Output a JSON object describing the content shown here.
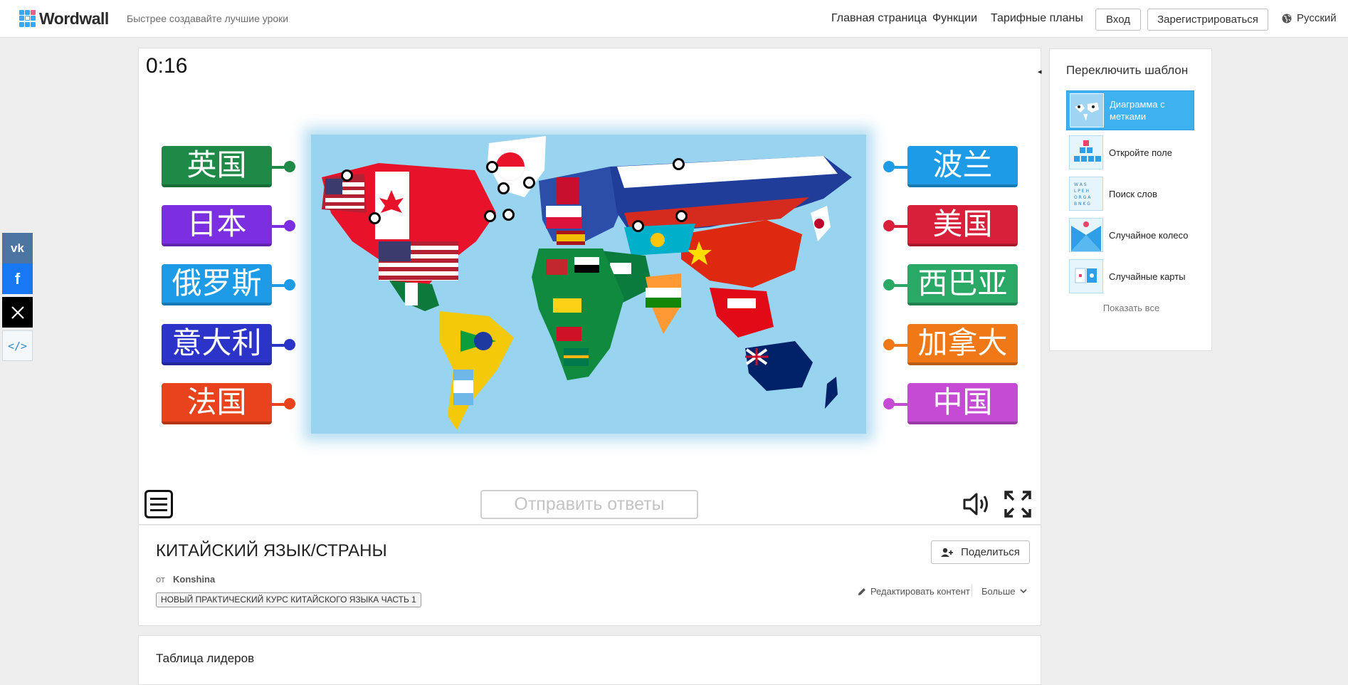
{
  "header": {
    "logo_text": "Wordwall",
    "tagline": "Быстрее создавайте лучшие уроки",
    "nav": [
      "Главная страница",
      "Функции",
      "Тарифные планы"
    ],
    "login_label": "Вход",
    "register_label": "Зарегистрироваться",
    "language": "Русский"
  },
  "share_sidebar": [
    "vk-icon",
    "facebook-icon",
    "x-icon",
    "embed-icon"
  ],
  "game": {
    "timer": "0:16",
    "submit_label": "Отправить ответы",
    "left_labels": [
      {
        "text": "英国",
        "color": "#1f8a47"
      },
      {
        "text": "日本",
        "color": "#7b2fe0"
      },
      {
        "text": "俄罗斯",
        "color": "#1e9be6"
      },
      {
        "text": "意大利",
        "color": "#2b33c9"
      },
      {
        "text": "法国",
        "color": "#e8431c"
      }
    ],
    "right_labels": [
      {
        "text": "波兰",
        "color": "#1e9be6"
      },
      {
        "text": "美国",
        "color": "#d9203a"
      },
      {
        "text": "西巴亚",
        "color": "#2aa866"
      },
      {
        "text": "加拿大",
        "color": "#f07816"
      },
      {
        "text": "中国",
        "color": "#c54bd4"
      }
    ]
  },
  "activity": {
    "title": "КИТАЙСКИЙ ЯЗЫК/СТРАНЫ",
    "by_label": "от",
    "author": "Konshina",
    "tag": "НОВЫЙ ПРАКТИЧЕСКИЙ КУРС КИТАЙСКОГО ЯЗЫКА ЧАСТЬ 1",
    "share_label": "Поделиться",
    "edit_label": "Редактировать контент",
    "more_label": "Больше"
  },
  "leaderboard": {
    "title": "Таблица лидеров"
  },
  "switch_template": {
    "title": "Переключить шаблон",
    "templates": [
      {
        "label": "Диаграмма с метками",
        "icon": "labelled-diagram-icon",
        "active": true
      },
      {
        "label": "Откройте поле",
        "icon": "open-box-icon",
        "active": false
      },
      {
        "label": "Поиск слов",
        "icon": "wordsearch-icon",
        "active": false
      },
      {
        "label": "Случайное колесо",
        "icon": "random-wheel-icon",
        "active": false
      },
      {
        "label": "Случайные карты",
        "icon": "random-cards-icon",
        "active": false
      }
    ],
    "show_all": "Показать все"
  }
}
